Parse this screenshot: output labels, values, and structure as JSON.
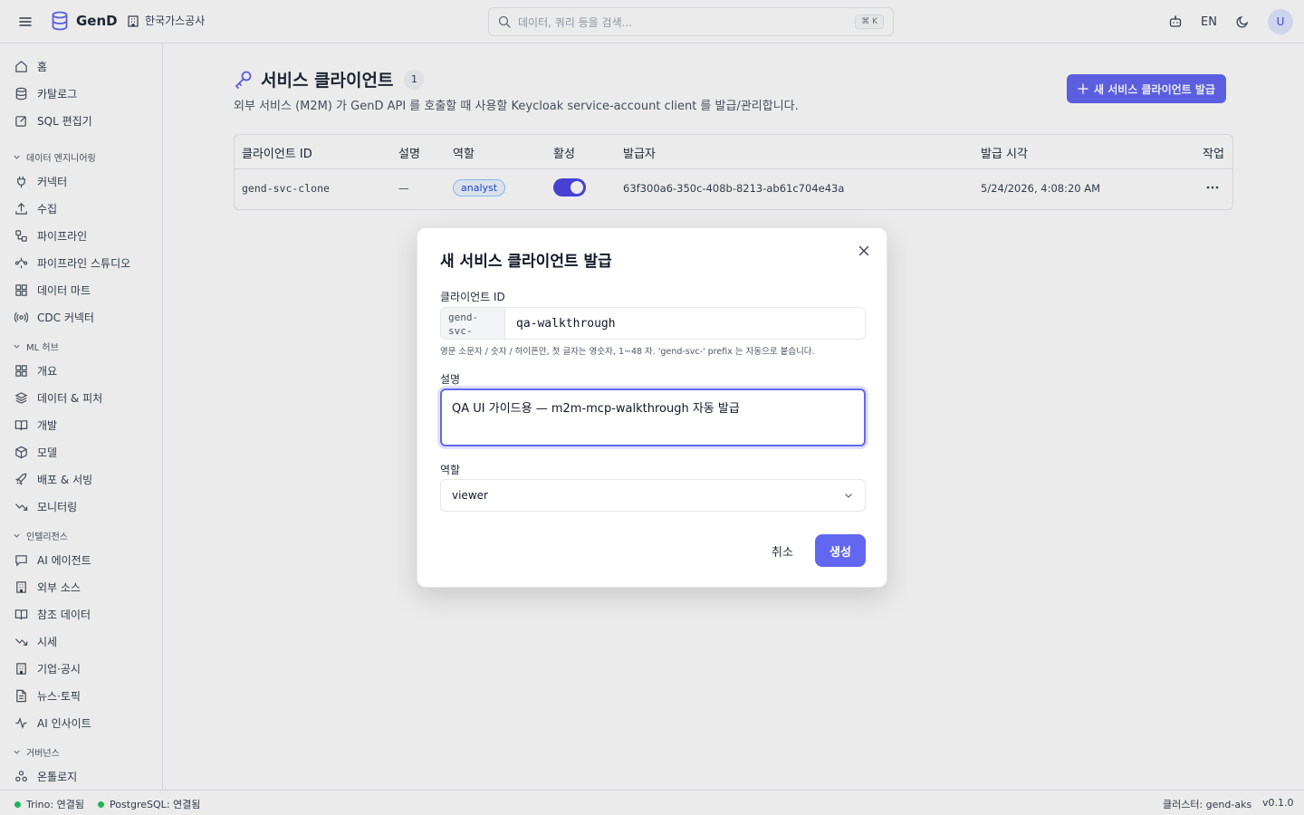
{
  "topbar": {
    "brand": "GenD",
    "org": "한국가스공사",
    "search_placeholder": "데이터, 쿼리 등을 검색...",
    "search_shortcut": "⌘ K",
    "lang": "EN",
    "avatar": "U"
  },
  "sidebar": {
    "items_top": [
      {
        "label": "홈",
        "icon": "home-icon"
      },
      {
        "label": "카탈로그",
        "icon": "database-icon"
      },
      {
        "label": "SQL 편집기",
        "icon": "edit-icon"
      }
    ],
    "groups": [
      {
        "label": "데이터 엔지니어링",
        "items": [
          {
            "label": "커넥터",
            "icon": "plug-icon"
          },
          {
            "label": "수집",
            "icon": "upload-icon"
          },
          {
            "label": "파이프라인",
            "icon": "workflow-icon"
          },
          {
            "label": "파이프라인 스튜디오",
            "icon": "waypoints-icon"
          },
          {
            "label": "데이터 마트",
            "icon": "grid-icon"
          },
          {
            "label": "CDC 커넥터",
            "icon": "radio-icon"
          }
        ]
      },
      {
        "label": "ML 허브",
        "items": [
          {
            "label": "개요",
            "icon": "grid-icon"
          },
          {
            "label": "데이터 & 피처",
            "icon": "layers-icon"
          },
          {
            "label": "개발",
            "icon": "book-icon"
          },
          {
            "label": "모델",
            "icon": "box-icon"
          },
          {
            "label": "배포 & 서빙",
            "icon": "rocket-icon"
          },
          {
            "label": "모니터링",
            "icon": "trend-icon"
          }
        ]
      },
      {
        "label": "인텔리전스",
        "items": [
          {
            "label": "AI 에이전트",
            "icon": "chat-icon"
          },
          {
            "label": "외부 소스",
            "icon": "building-icon"
          },
          {
            "label": "참조 데이터",
            "icon": "book-icon"
          },
          {
            "label": "시세",
            "icon": "trend-icon"
          },
          {
            "label": "기업·공시",
            "icon": "building-icon"
          },
          {
            "label": "뉴스·토픽",
            "icon": "file-icon"
          },
          {
            "label": "AI 인사이트",
            "icon": "activity-icon"
          }
        ]
      },
      {
        "label": "거버넌스",
        "items": [
          {
            "label": "온톨로지",
            "icon": "network-icon"
          }
        ]
      }
    ]
  },
  "page": {
    "title": "서비스 클라이언트",
    "count": "1",
    "description": "외부 서비스 (M2M) 가 GenD API 를 호출할 때 사용할 Keycloak service-account client 를 발급/관리합니다.",
    "new_button": "새 서비스 클라이언트 발급"
  },
  "table": {
    "headers": [
      "클라이언트 ID",
      "설명",
      "역할",
      "활성",
      "발급자",
      "발급 시각",
      "작업"
    ],
    "rows": [
      {
        "client_id": "gend-svc-clone",
        "description": "—",
        "role": "analyst",
        "active": true,
        "issuer": "63f300a6-350c-408b-8213-ab61c704e43a",
        "issued_at": "5/24/2026, 4:08:20 AM"
      }
    ]
  },
  "modal": {
    "title": "새 서비스 클라이언트 발급",
    "client_id_label": "클라이언트 ID",
    "prefix": "gend-svc-",
    "client_id_value": "qa-walkthrough",
    "hint": "영문 소문자 / 숫자 / 하이픈만, 첫 글자는 영숫자, 1~48 자. 'gend-svc-' prefix 는 자동으로 붙습니다.",
    "description_label": "설명",
    "description_value": "QA UI 가이드용 — m2m-mcp-walkthrough 자동 발급",
    "role_label": "역할",
    "role_value": "viewer",
    "cancel": "취소",
    "create": "생성"
  },
  "status": {
    "trino": "Trino: 연결됨",
    "postgres": "PostgreSQL: 연결됨",
    "cluster": "클러스터: gend-aks",
    "version": "v0.1.0"
  },
  "colors": {
    "accent": "#6366f1",
    "status_ok": "#22c55e"
  }
}
